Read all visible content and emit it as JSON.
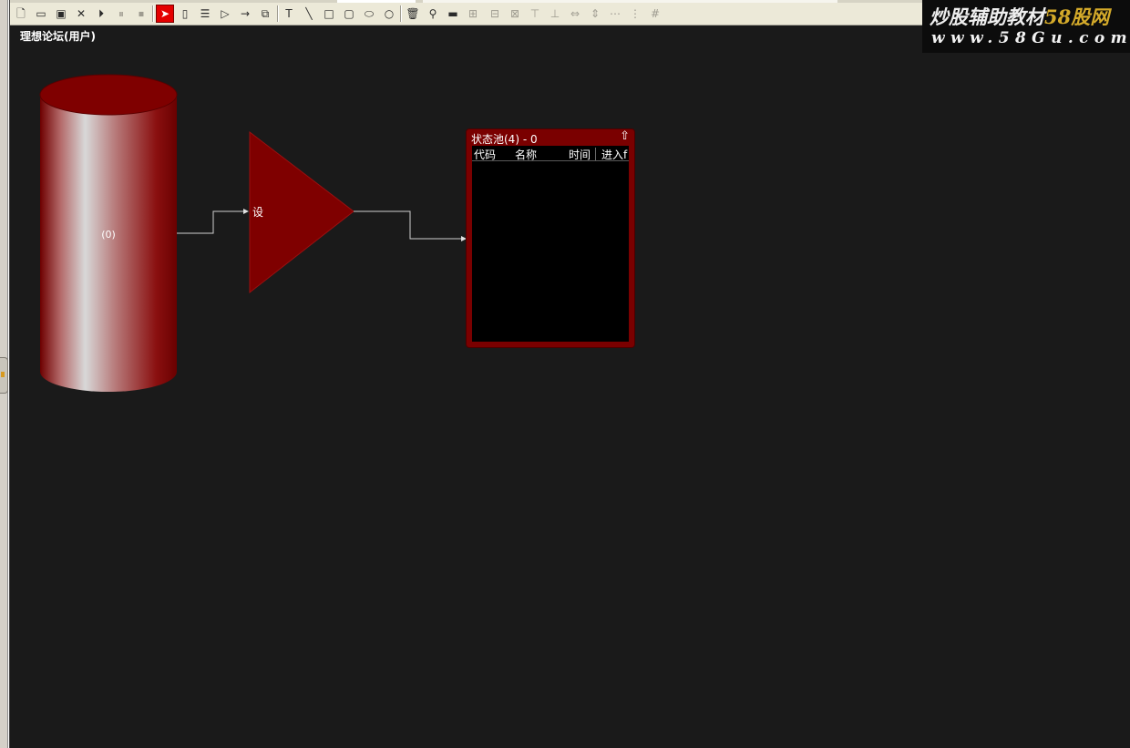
{
  "canvas": {
    "title": "理想论坛(用户)"
  },
  "watermark": {
    "title_white": "炒股辅助教材",
    "title_gold": "58股网",
    "url": "www.58Gu.com"
  },
  "toolbar": {
    "icons": [
      "new-icon",
      "open-icon",
      "save-icon",
      "close-icon",
      "play-icon",
      "pause-icon",
      "stop-icon",
      "select-pointer-icon",
      "rectangle-node-icon",
      "list-node-icon",
      "triangle-node-icon",
      "arrow-link-icon",
      "group-node-icon",
      "text-tool-icon",
      "line-tool-icon",
      "square-tool-icon",
      "rounded-rect-tool-icon",
      "ellipse-tool-icon",
      "circle-tool-icon",
      "delete-icon",
      "paint-icon",
      "line-width-icon",
      "align-icon",
      "align-left-icon",
      "align-right-icon",
      "align-top-icon",
      "align-bottom-icon",
      "same-width-icon",
      "same-height-icon",
      "distribute-h-icon",
      "distribute-v-icon",
      "grid-icon"
    ]
  },
  "diagram": {
    "cylinder": {
      "label": "(0)"
    },
    "triangle": {
      "label": "设"
    },
    "pool": {
      "title": "状态池(4) - 0",
      "columns": [
        "代码",
        "名称",
        "时间",
        "进入f"
      ]
    }
  },
  "colors": {
    "node_red": "#7f0000",
    "canvas_bg": "#1a1a1a",
    "connector": "#d0d0d0"
  }
}
